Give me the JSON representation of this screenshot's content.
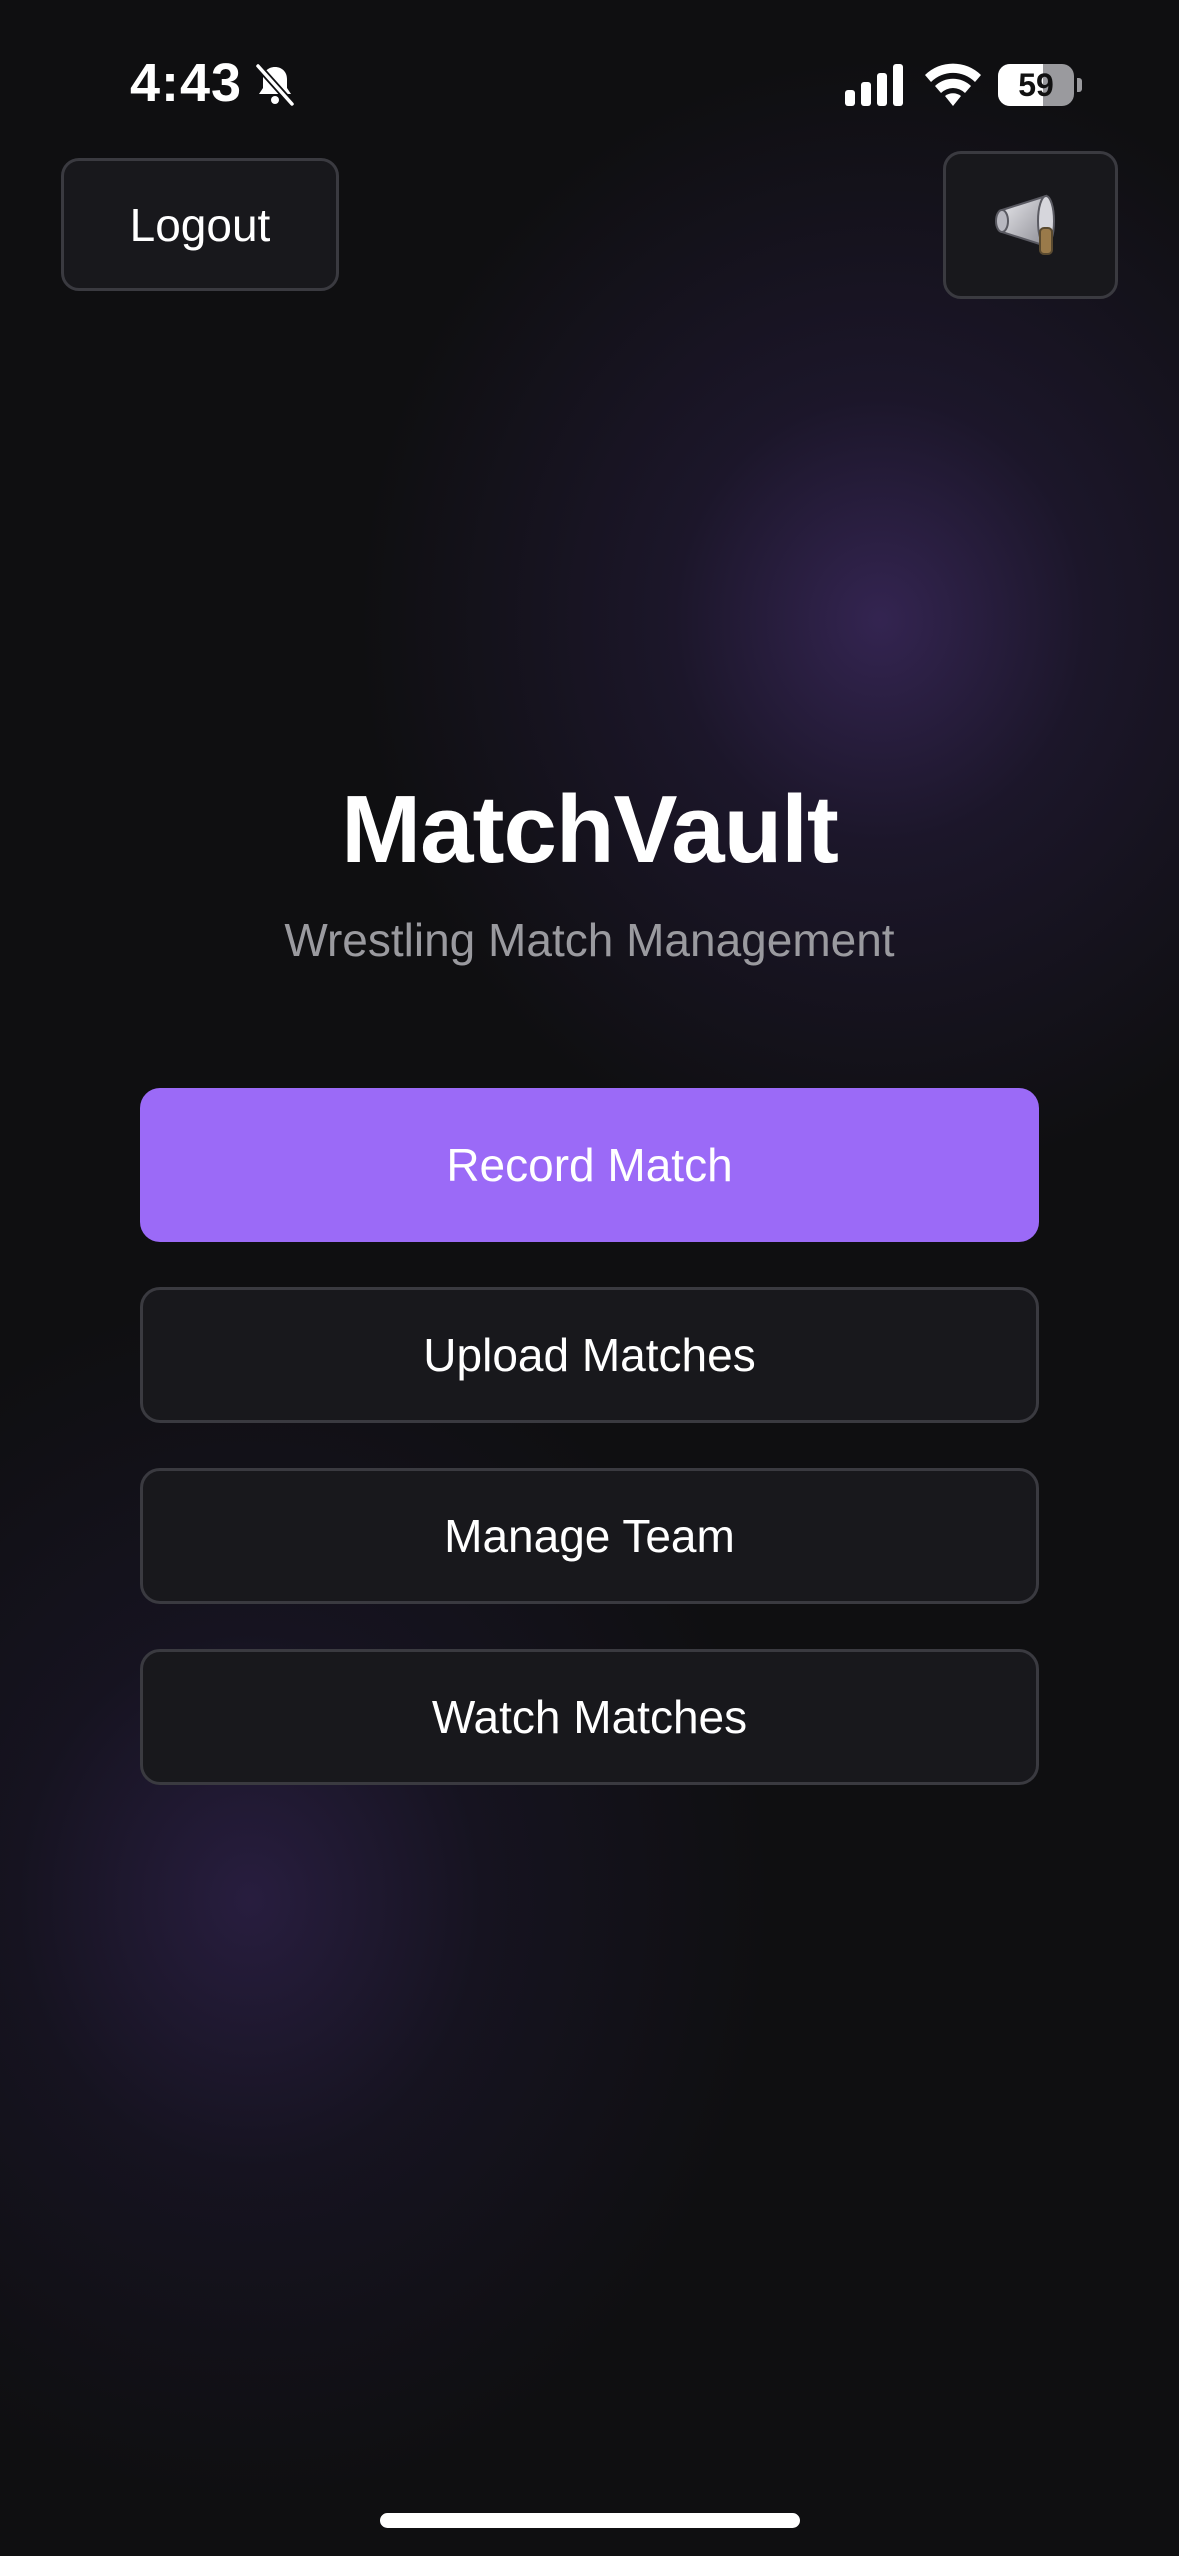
{
  "status_bar": {
    "time": "4:43",
    "battery_level": "59",
    "battery_fraction": 0.59,
    "icons": [
      "bell-slash-icon",
      "cellular-signal-icon",
      "wifi-icon",
      "battery-icon"
    ]
  },
  "header": {
    "logout_label": "Logout",
    "announce_icon": "megaphone-icon"
  },
  "main": {
    "title": "MatchVault",
    "subtitle": "Wrestling Match Management",
    "actions": {
      "record": "Record Match",
      "upload": "Upload Matches",
      "team": "Manage Team",
      "watch": "Watch Matches"
    }
  },
  "colors": {
    "background": "#0f0f11",
    "accent": "#9b6af7",
    "button_bg": "#18181c",
    "button_border": "#3a3a40",
    "subtitle": "#9a9a9f"
  }
}
